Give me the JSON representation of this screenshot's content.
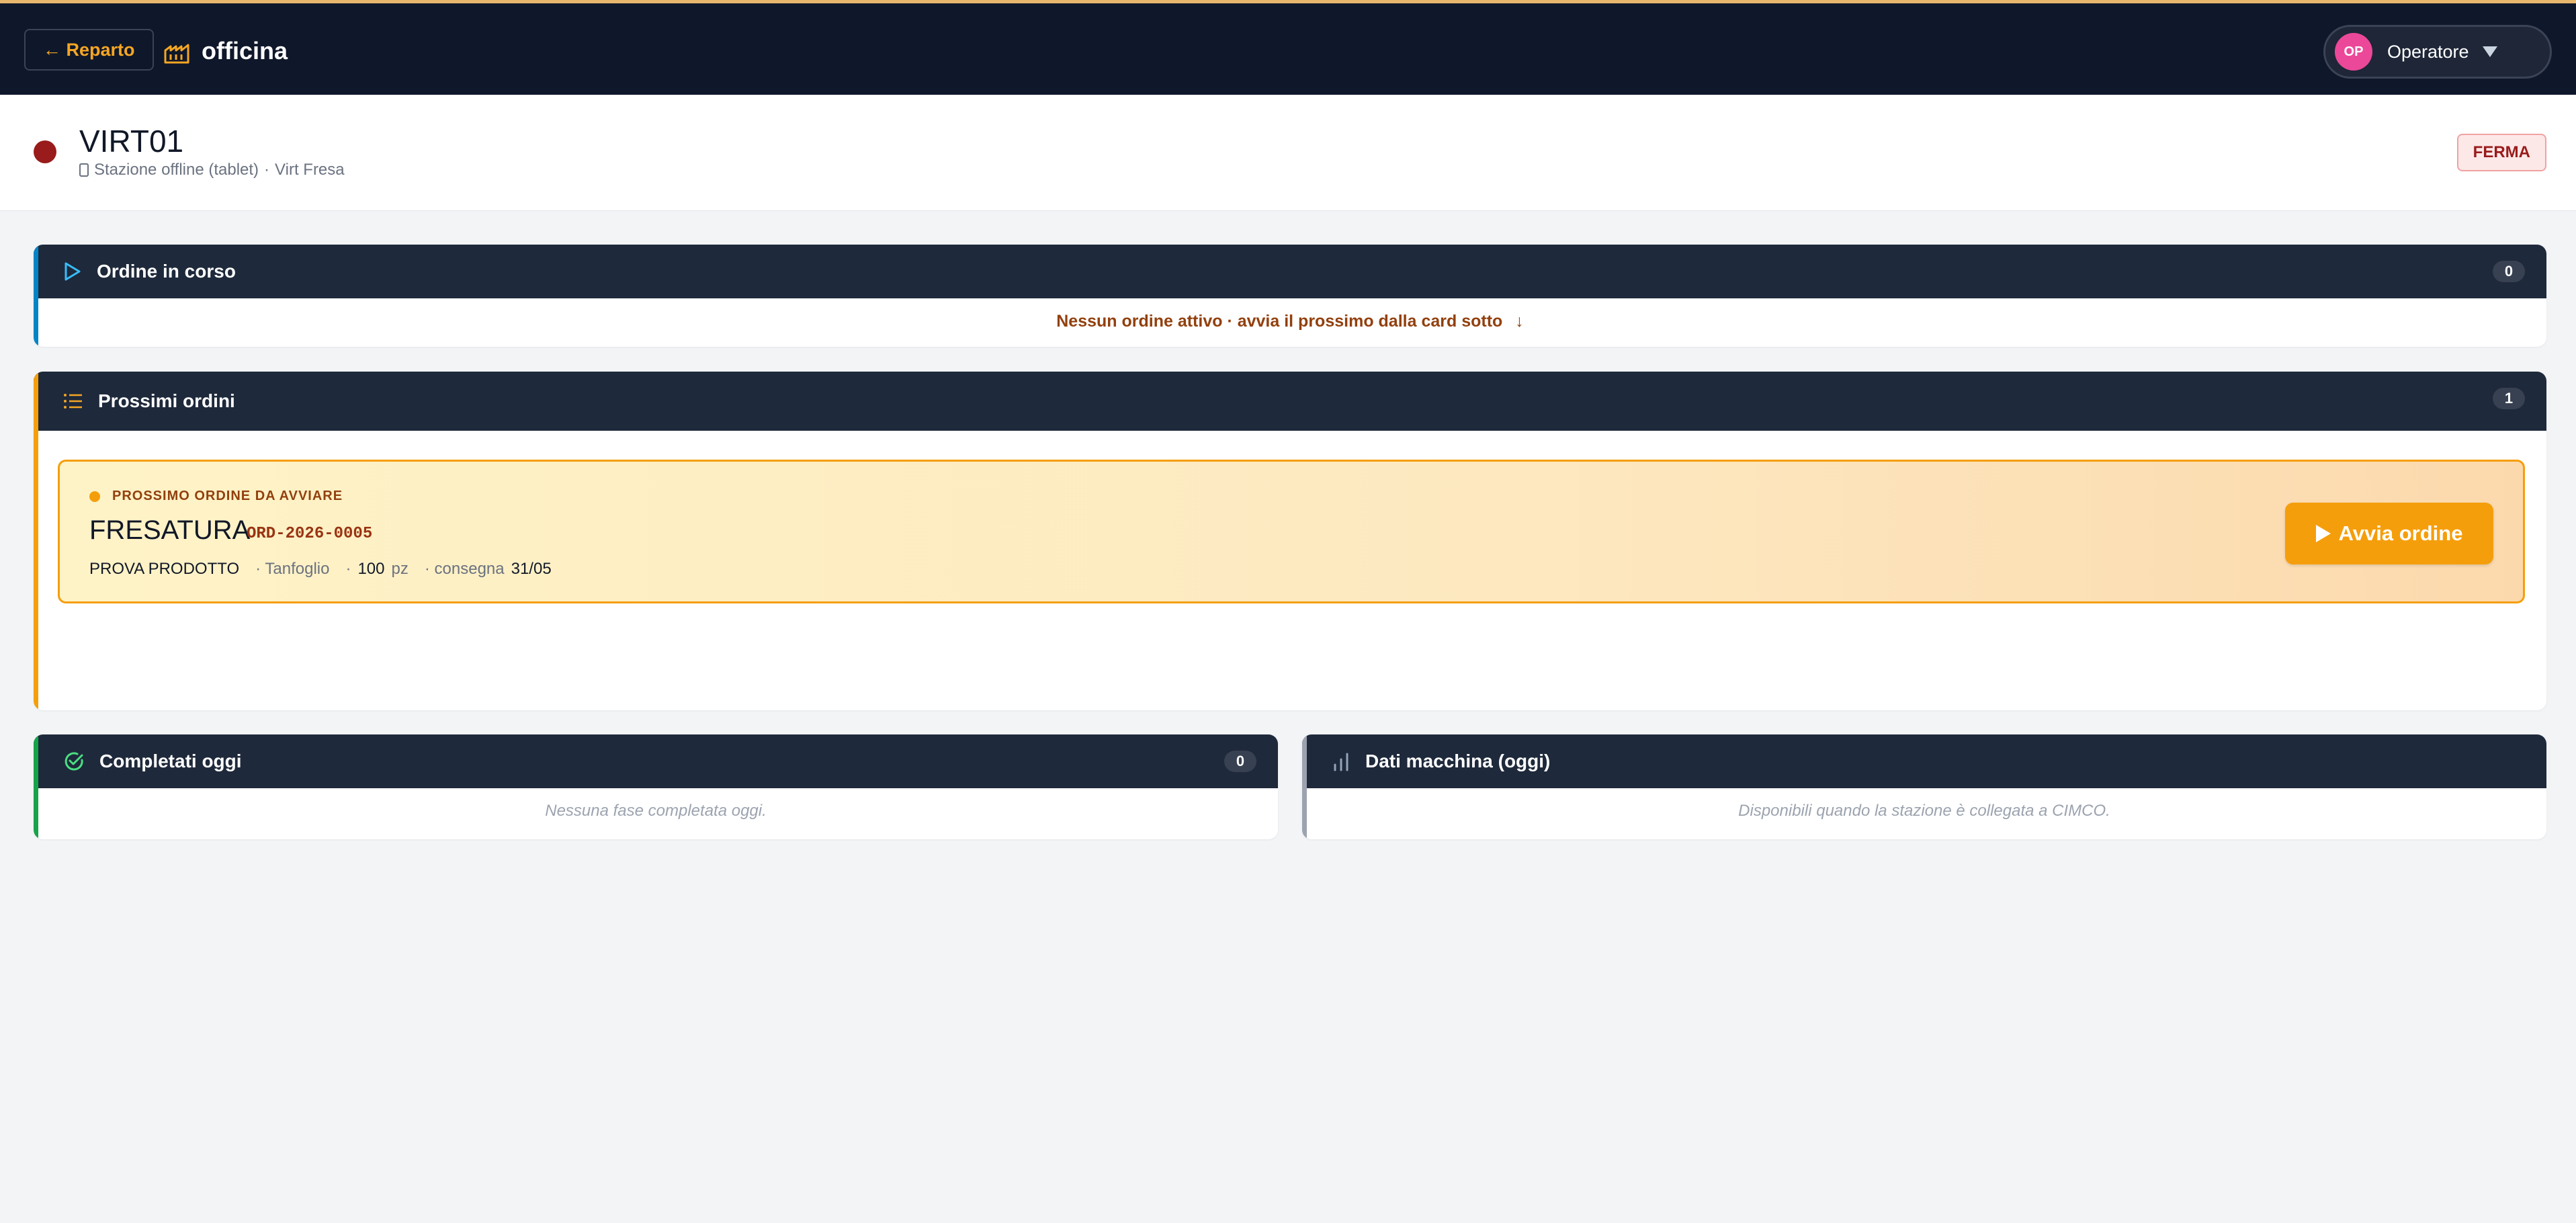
{
  "topbar": {
    "back_label": "← Reparto",
    "app_name": "officina",
    "app_icon": "factory-icon",
    "user": {
      "initials": "OP",
      "name": "Operatore"
    }
  },
  "station": {
    "name": "VIRT01",
    "subtitle_mode": "Stazione offline (tablet)",
    "subtitle_machine": "Virt Fresa",
    "status_badge": "FERMA"
  },
  "ordine_in_corso": {
    "title": "Ordine in corso",
    "count": "0",
    "message": "Nessun ordine attivo · avvia il prossimo dalla card sotto",
    "arrow": "↓"
  },
  "prossimi_ordini": {
    "title": "Prossimi ordini",
    "count": "1",
    "next": {
      "label": "PROSSIMO ORDINE DA AVVIARE",
      "phase": "FRESATURA",
      "code": "ORD-2026-0005",
      "product": "PROVA PRODOTTO",
      "customer": "· Tanfoglio",
      "qty_prefix": "·",
      "qty": "100",
      "qty_unit": "pz",
      "delivery_prefix": "· consegna",
      "delivery": "31/05",
      "start_button": "Avvia ordine"
    }
  },
  "completati_oggi": {
    "title": "Completati oggi",
    "count": "0",
    "empty": "Nessuna fase completata oggi."
  },
  "dati_macchina": {
    "title": "Dati macchina (oggi)",
    "empty": "Disponibili quando la stazione è collegata a CIMCO."
  },
  "colors": {
    "topbar_bg": "#0f172a",
    "card_header_bg": "#1e293b",
    "accent_orange": "#f59e0b",
    "status_red": "#991b1b",
    "accent_blue": "#0284c7",
    "accent_green": "#16a34a"
  }
}
